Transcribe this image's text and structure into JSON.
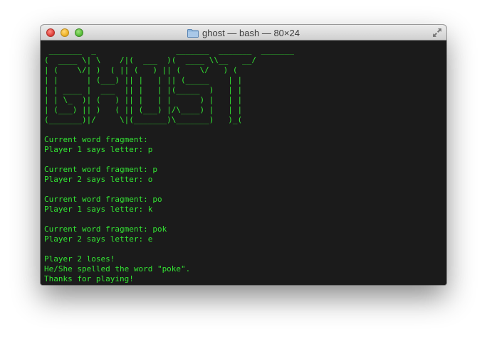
{
  "window": {
    "title": "ghost — bash — 80×24"
  },
  "terminal": {
    "text_color": "#33e633",
    "background": "#1b1b1b",
    "ascii_art": [
      " _______  _                 _______  _______  _______ ",
      "(  ____ \\| \\    /|(  ___  )(  ____ \\\\__   __/",
      "| (    \\/| )  ( || (   ) || (    \\/   ) (   ",
      "| |      | (___) || |   | || (_____    | |   ",
      "| | ____ |  ___  || |   | |(_____  )   | |   ",
      "| | \\_  )| (   ) || |   | |      ) |   | |   ",
      "| (___) || )   ( || (___) |/\\____) |   | |   ",
      "(_______)|/     \\|(_______)\\_______)   )_(   "
    ],
    "lines": [
      "",
      "Current word fragment: ",
      "Player 1 says letter: p",
      "",
      "Current word fragment: p",
      "Player 2 says letter: o",
      "",
      "Current word fragment: po",
      "Player 1 says letter: k",
      "",
      "Current word fragment: pok",
      "Player 2 says letter: e",
      "",
      "Player 2 loses!",
      "He/She spelled the word \"poke\".",
      "Thanks for playing!"
    ]
  }
}
